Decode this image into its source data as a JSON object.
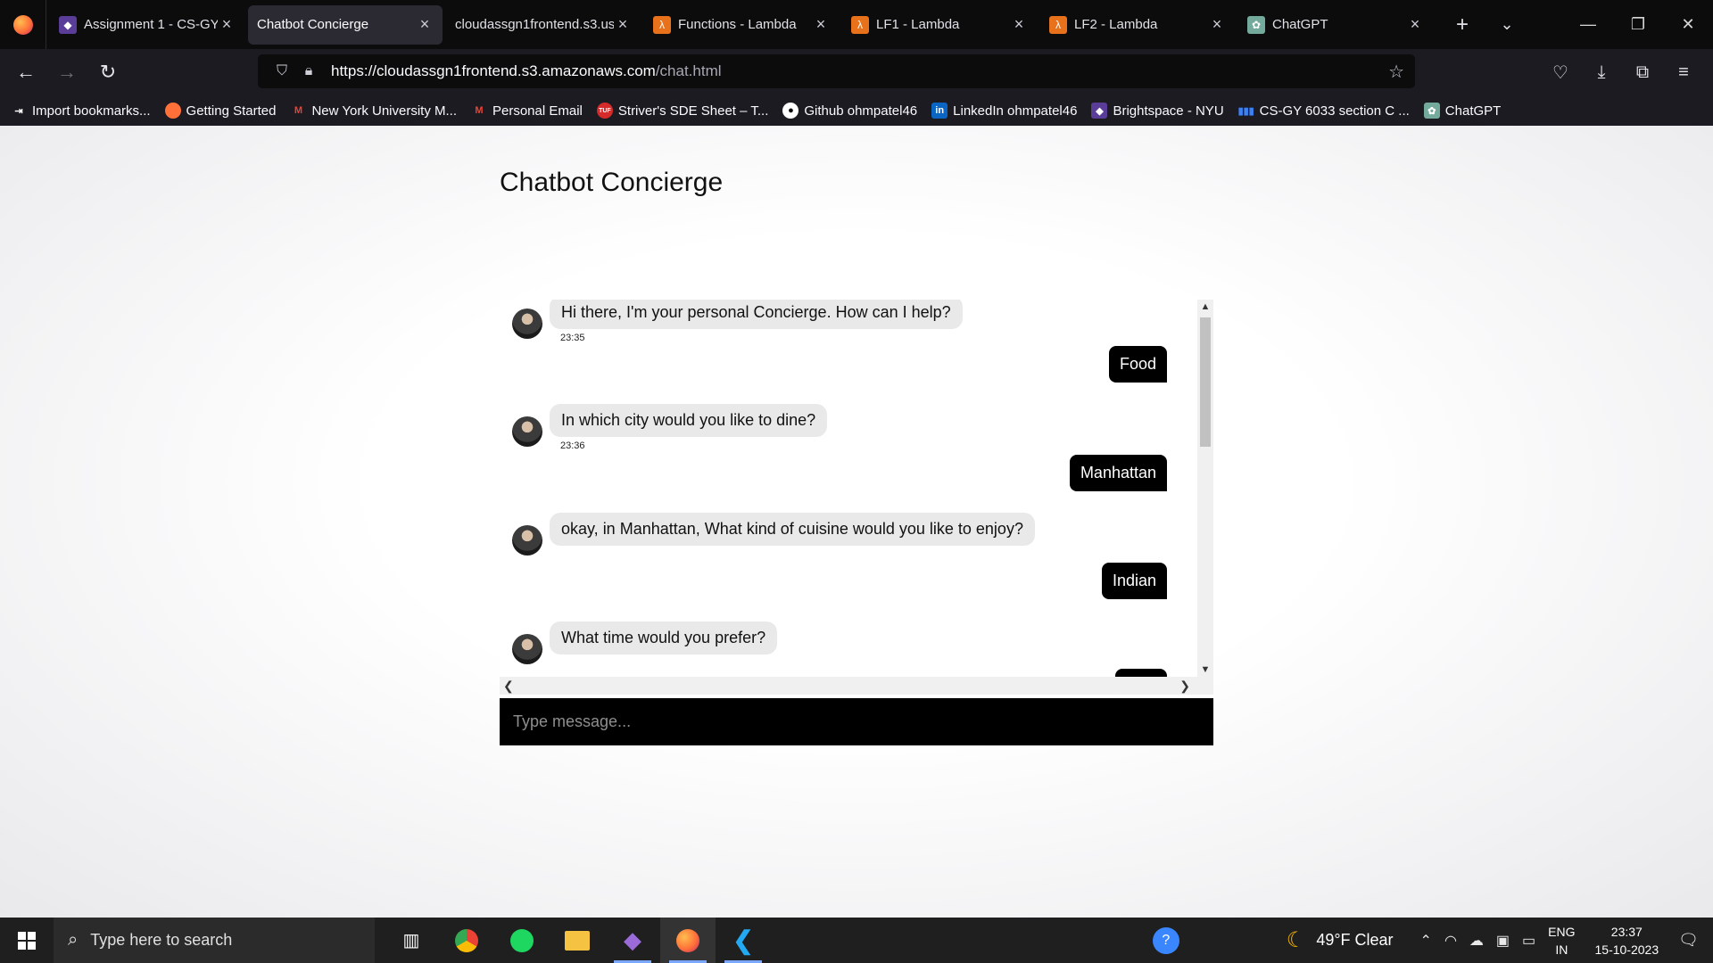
{
  "browser": {
    "tabs": [
      {
        "title": "Assignment 1 - CS-GY",
        "icon": "brightspace-icon",
        "color": "#5a3d99",
        "active": false
      },
      {
        "title": "Chatbot Concierge",
        "icon": "",
        "color": "#2b2a33",
        "active": true
      },
      {
        "title": "cloudassgn1frontend.s3.us",
        "icon": "",
        "color": "#0c0c0d",
        "active": false
      },
      {
        "title": "Functions - Lambda",
        "icon": "lambda-icon",
        "color": "#e8721c",
        "active": false
      },
      {
        "title": "LF1 - Lambda",
        "icon": "lambda-icon",
        "color": "#e8721c",
        "active": false
      },
      {
        "title": "LF2 - Lambda",
        "icon": "lambda-icon",
        "color": "#e8721c",
        "active": false
      },
      {
        "title": "ChatGPT",
        "icon": "chatgpt-icon",
        "color": "#74aa9c",
        "active": false
      }
    ],
    "url_host": "https://cloudassgn1frontend.s3.amazonaws.com",
    "url_path": "/chat.html",
    "bookmarks": [
      {
        "label": "Import bookmarks...",
        "icon": "import-icon",
        "color": "#1c1b22"
      },
      {
        "label": "Getting Started",
        "icon": "firefox-icon",
        "color": "#ff7139"
      },
      {
        "label": "New York University M...",
        "icon": "gmail-icon",
        "color": "#ea4335"
      },
      {
        "label": "Personal Email",
        "icon": "gmail-icon",
        "color": "#ea4335"
      },
      {
        "label": "Striver's SDE Sheet – T...",
        "icon": "tuf-icon",
        "color": "#d62b2b"
      },
      {
        "label": "Github ohmpatel46",
        "icon": "github-icon",
        "color": "#ffffff"
      },
      {
        "label": "LinkedIn ohmpatel46",
        "icon": "linkedin-icon",
        "color": "#0a66c2"
      },
      {
        "label": "Brightspace - NYU",
        "icon": "brightspace-icon",
        "color": "#5a3d99"
      },
      {
        "label": "CS-GY 6033 section C ...",
        "icon": "bars-icon",
        "color": "#3b82f6"
      },
      {
        "label": "ChatGPT",
        "icon": "chatgpt-icon",
        "color": "#74aa9c"
      }
    ]
  },
  "page": {
    "title": "Chatbot Concierge",
    "input_placeholder": "Type message..."
  },
  "messages": {
    "m1": {
      "text": "Hi there, I'm your personal Concierge. How can I help?",
      "time": "23:35"
    },
    "u1": {
      "text": "Food"
    },
    "m2": {
      "text": "In which city would you like to dine?",
      "time": "23:36"
    },
    "u2": {
      "text": "Manhattan"
    },
    "m3": {
      "text": "okay, in Manhattan, What kind of cuisine would you like to enjoy?"
    },
    "u3": {
      "text": "Indian"
    },
    "m4": {
      "text": "What time would you prefer?"
    }
  },
  "taskbar": {
    "search_placeholder": "Type here to search",
    "weather": "49°F  Clear",
    "lang_top": "ENG",
    "lang_bottom": "IN",
    "time": "23:37",
    "date": "15-10-2023"
  }
}
